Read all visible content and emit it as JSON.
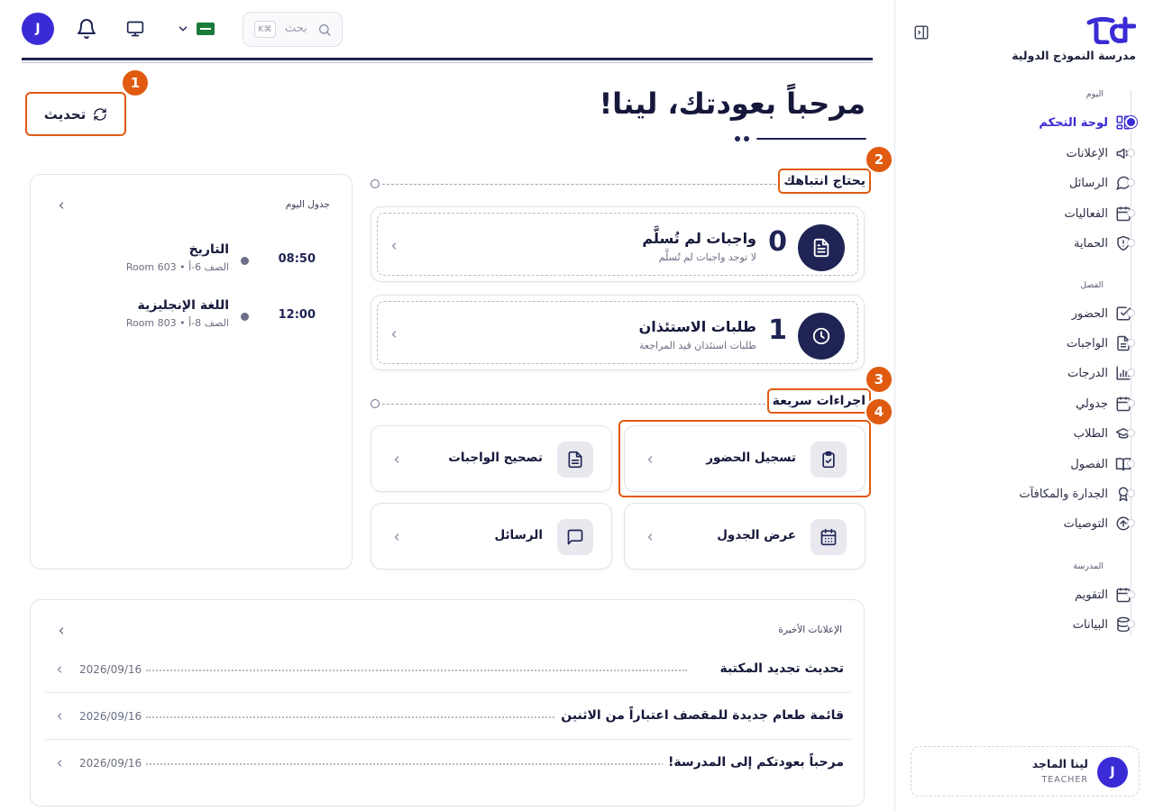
{
  "topbar": {
    "avatar_letter": "J",
    "search_placeholder": "بحث",
    "search_shortcut": "K⌘",
    "flag": "🇸🇦"
  },
  "sidebar": {
    "school_name": "مدرسة النموذج الدولية",
    "sections": [
      {
        "label": "اليوم",
        "items": [
          {
            "label": "لوحة التحكم",
            "icon": "dashboard-icon",
            "active": true
          },
          {
            "label": "الإعلانات",
            "icon": "megaphone-icon"
          },
          {
            "label": "الرسائل",
            "icon": "chat-icon"
          },
          {
            "label": "الفعاليات",
            "icon": "calendar-icon"
          },
          {
            "label": "الحماية",
            "icon": "shield-icon"
          }
        ]
      },
      {
        "label": "الفصل",
        "items": [
          {
            "label": "الحضور",
            "icon": "check-square-icon"
          },
          {
            "label": "الواجبات",
            "icon": "document-icon"
          },
          {
            "label": "الدرجات",
            "icon": "bar-chart-icon"
          },
          {
            "label": "جدولي",
            "icon": "calendar-icon"
          },
          {
            "label": "الطلاب",
            "icon": "graduation-cap-icon"
          },
          {
            "label": "الفصول",
            "icon": "book-icon"
          },
          {
            "label": "الجدارة والمكافآت",
            "icon": "award-icon"
          },
          {
            "label": "التوصيات",
            "icon": "arrow-up-circle-icon"
          }
        ]
      },
      {
        "label": "المدرسة",
        "items": [
          {
            "label": "التقويم",
            "icon": "calendar-icon"
          },
          {
            "label": "البيانات",
            "icon": "database-icon"
          }
        ]
      }
    ],
    "user": {
      "avatar_letter": "J",
      "name": "لينا الماجد",
      "role": "TEACHER"
    }
  },
  "header": {
    "welcome": "مرحباً بعودتك، لينا!",
    "refresh_label": "تحديث"
  },
  "badges": [
    "1",
    "2",
    "3",
    "4"
  ],
  "attention": {
    "title": "يحتاج انتباهك",
    "cards": [
      {
        "count": "0",
        "title": "واجبات لم تُسلَّم",
        "subtitle": "لا توجد واجبات لم تُسلَّم",
        "icon": "document-icon"
      },
      {
        "count": "1",
        "title": "طلبات الاستئذان",
        "subtitle": "طلبات استئذان قيد المراجعة",
        "icon": "clock-icon"
      }
    ]
  },
  "quick_actions": {
    "title": "اجراءات سريعة",
    "items": [
      {
        "label": "تسجيل الحضور",
        "icon": "clipboard-check-icon"
      },
      {
        "label": "تصحيح الواجبات",
        "icon": "document-icon"
      },
      {
        "label": "عرض الجدول",
        "icon": "calendar-icon"
      },
      {
        "label": "الرسائل",
        "icon": "chat-icon"
      }
    ]
  },
  "schedule": {
    "title": "جدول اليوم",
    "entries": [
      {
        "time": "08:50",
        "subject": "التاريخ",
        "room": "الصف 6-أ • Room 603"
      },
      {
        "time": "12:00",
        "subject": "اللغة الإنجليزية",
        "room": "الصف 8-أ • Room 803"
      }
    ]
  },
  "announcements": {
    "title": "الإعلانات الأخيرة",
    "items": [
      {
        "text": "تحديث تجديد المكتبة",
        "date": "2026/09/16"
      },
      {
        "text": "قائمة طعام جديدة للمقصف اعتباراً من الاثنين",
        "date": "2026/09/16"
      },
      {
        "text": "مرحباً بعودتكم إلى المدرسة!",
        "date": "2026/09/16"
      }
    ]
  },
  "colors": {
    "accent": "#3a2bd6",
    "navy": "#1f2454",
    "highlight": "#e05a10"
  }
}
